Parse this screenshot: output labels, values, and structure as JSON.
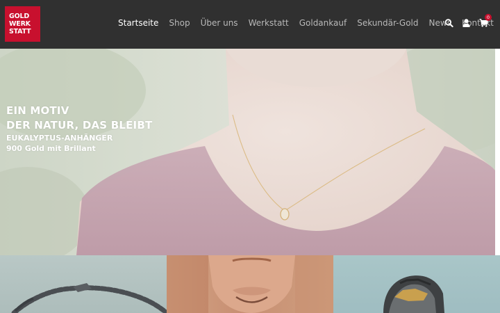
{
  "brand": {
    "logo_lines": [
      "GOLD",
      "WERK",
      "STATT"
    ],
    "color": "#c8102e"
  },
  "nav": {
    "items": [
      "Startseite",
      "Shop",
      "Über uns",
      "Werkstatt",
      "Goldankauf",
      "Sekundär-Gold",
      "News",
      "Kontakt"
    ],
    "active": "Startseite"
  },
  "header_icons": {
    "search": "search-icon",
    "account": "user-icon",
    "cart": "cart-icon",
    "cart_count": "0"
  },
  "hero": {
    "headline_line1": "EIN MOTIV",
    "headline_line2": "DER NATUR, DAS BLEIBT",
    "subtitle_line1": "EUKALYPTUS-ANHÄNGER",
    "subtitle_line2": "900 Gold mit Brillant"
  },
  "colors": {
    "header_bg": "#303030",
    "nav_text": "#b9b9b9",
    "nav_active": "#ffffff",
    "accent": "#c8102e"
  }
}
